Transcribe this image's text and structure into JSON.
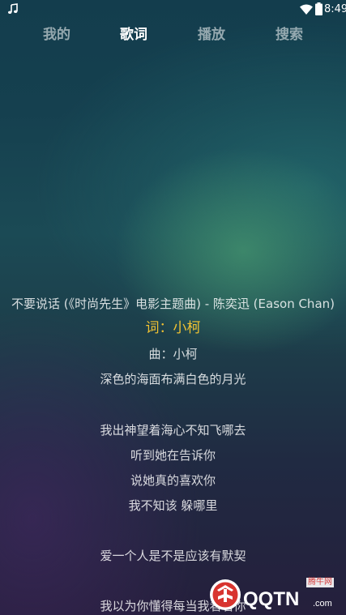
{
  "status_bar": {
    "time": "8:49",
    "icons": [
      "music-note-icon",
      "wifi-icon",
      "battery-icon"
    ]
  },
  "tabs": [
    {
      "label": "我的",
      "active": false
    },
    {
      "label": "歌词",
      "active": true
    },
    {
      "label": "播放",
      "active": false
    },
    {
      "label": "搜索",
      "active": false
    }
  ],
  "lyrics": {
    "title_line": "不要说话 (《时尚先生》电影主题曲) - 陈奕迅 (Eason Chan)",
    "lines": [
      "词：小柯",
      "曲：小柯",
      "深色的海面布满白色的月光",
      "",
      "我出神望着海心不知飞哪去",
      "听到她在告诉你",
      "说她真的喜欢你",
      "我不知该 躲哪里",
      "",
      "爱一个人是不是应该有默契",
      "",
      "我以为你懂得每当我看着你"
    ],
    "current_line_color": "#f1c232"
  },
  "watermark": {
    "site_name": "腾牛网",
    "brand": "QQTN",
    "domain": ".com",
    "icon": "qqtn-logo-icon"
  },
  "colors": {
    "background_top": "#133d4d",
    "background_glow": "#46966e",
    "background_bottom": "#251f3c",
    "tab_active": "#ffffff",
    "tab_inactive": "rgba(255,255,255,0.55)"
  }
}
